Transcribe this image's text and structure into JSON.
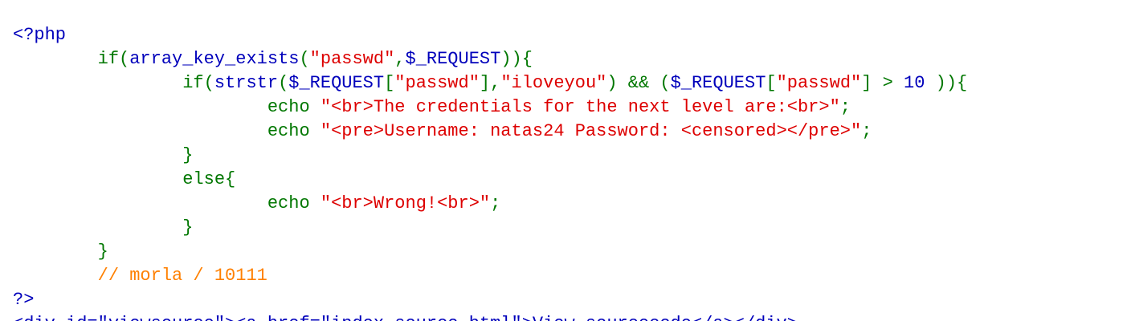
{
  "code": {
    "language": "php",
    "colors": {
      "default": "#0000BB",
      "keyword": "#007700",
      "string": "#DD0000",
      "comment": "#FF8000"
    },
    "lines": [
      [
        {
          "t": "default",
          "v": "<?php"
        }
      ],
      [
        {
          "t": "keyword",
          "v": "        if("
        },
        {
          "t": "default",
          "v": "array_key_exists"
        },
        {
          "t": "keyword",
          "v": "("
        },
        {
          "t": "string",
          "v": "\"passwd\""
        },
        {
          "t": "keyword",
          "v": ","
        },
        {
          "t": "default",
          "v": "$_REQUEST"
        },
        {
          "t": "keyword",
          "v": ")){"
        }
      ],
      [
        {
          "t": "keyword",
          "v": "                if("
        },
        {
          "t": "default",
          "v": "strstr"
        },
        {
          "t": "keyword",
          "v": "("
        },
        {
          "t": "default",
          "v": "$_REQUEST"
        },
        {
          "t": "keyword",
          "v": "["
        },
        {
          "t": "string",
          "v": "\"passwd\""
        },
        {
          "t": "keyword",
          "v": "],"
        },
        {
          "t": "string",
          "v": "\"iloveyou\""
        },
        {
          "t": "keyword",
          "v": ") && ("
        },
        {
          "t": "default",
          "v": "$_REQUEST"
        },
        {
          "t": "keyword",
          "v": "["
        },
        {
          "t": "string",
          "v": "\"passwd\""
        },
        {
          "t": "keyword",
          "v": "] > "
        },
        {
          "t": "default",
          "v": "10"
        },
        {
          "t": "keyword",
          "v": " )){"
        }
      ],
      [
        {
          "t": "keyword",
          "v": "                        echo "
        },
        {
          "t": "string",
          "v": "\"<br>The credentials for the next level are:<br>\""
        },
        {
          "t": "keyword",
          "v": ";"
        }
      ],
      [
        {
          "t": "keyword",
          "v": "                        echo "
        },
        {
          "t": "string",
          "v": "\"<pre>Username: natas24 Password: <censored></pre>\""
        },
        {
          "t": "keyword",
          "v": ";"
        }
      ],
      [
        {
          "t": "keyword",
          "v": "                }"
        }
      ],
      [
        {
          "t": "keyword",
          "v": "                else{"
        }
      ],
      [
        {
          "t": "keyword",
          "v": "                        echo "
        },
        {
          "t": "string",
          "v": "\"<br>Wrong!<br>\""
        },
        {
          "t": "keyword",
          "v": ";"
        }
      ],
      [
        {
          "t": "keyword",
          "v": "                }"
        }
      ],
      [
        {
          "t": "keyword",
          "v": "        }"
        }
      ],
      [
        {
          "t": "comment",
          "v": "        // morla / 10111"
        }
      ],
      [
        {
          "t": "default",
          "v": "?>"
        }
      ],
      [
        {
          "t": "default",
          "v": "<div id=\"viewsource\"><a href=\"index-source.html\">View sourcecode</a></div>"
        }
      ]
    ]
  }
}
